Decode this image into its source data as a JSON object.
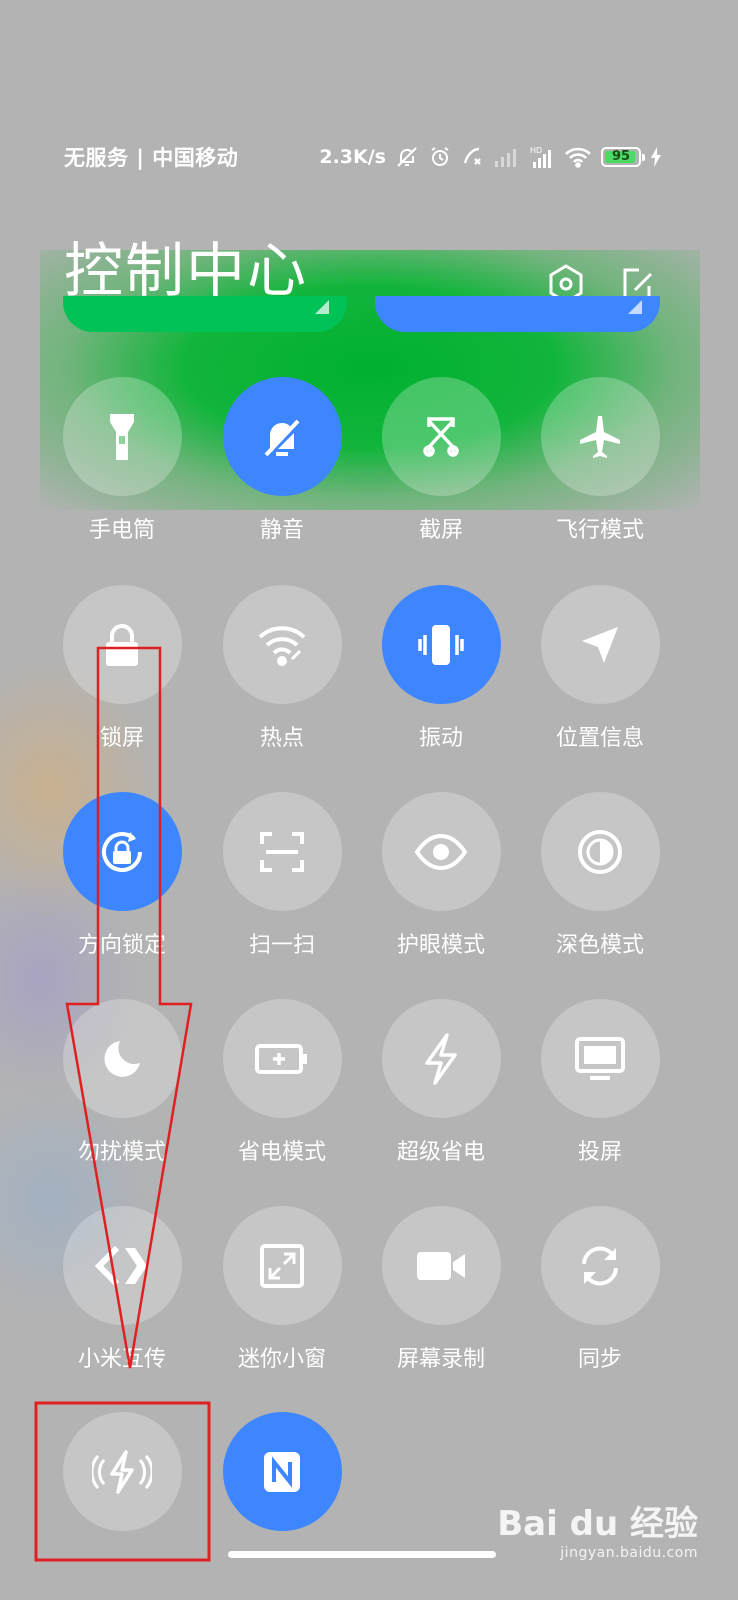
{
  "status_bar": {
    "carrier": "无服务 | 中国移动",
    "speed": "2.3K/s",
    "battery": "95",
    "icons": [
      "mute-bell-icon",
      "alarm-icon",
      "call-icon",
      "signal-icon",
      "hd-signal-icon",
      "wifi-icon",
      "battery-icon",
      "charging-icon"
    ]
  },
  "header": {
    "title": "控制中心",
    "icons": [
      "settings-hex-icon",
      "edit-icon"
    ]
  },
  "sliders": {
    "left_color": "#00c257",
    "right_color": "#3d86ff"
  },
  "accent": "#3d86ff",
  "tiles": [
    {
      "label": "手电筒",
      "icon": "flashlight-icon",
      "active": false
    },
    {
      "label": "静音",
      "icon": "mute-bell-icon",
      "active": true
    },
    {
      "label": "截屏",
      "icon": "screenshot-icon",
      "active": false
    },
    {
      "label": "飞行模式",
      "icon": "airplane-icon",
      "active": false
    },
    {
      "label": "锁屏",
      "icon": "lock-icon",
      "active": false
    },
    {
      "label": "热点",
      "icon": "hotspot-icon",
      "active": false
    },
    {
      "label": "振动",
      "icon": "vibrate-icon",
      "active": true
    },
    {
      "label": "位置信息",
      "icon": "location-icon",
      "active": false
    },
    {
      "label": "方向锁定",
      "icon": "rotation-lock-icon",
      "active": true
    },
    {
      "label": "扫一扫",
      "icon": "scan-icon",
      "active": false
    },
    {
      "label": "护眼模式",
      "icon": "eye-icon",
      "active": false
    },
    {
      "label": "深色模式",
      "icon": "dark-mode-icon",
      "active": false
    },
    {
      "label": "勿扰模式",
      "icon": "moon-icon",
      "active": false
    },
    {
      "label": "省电模式",
      "icon": "battery-saver-icon",
      "active": false
    },
    {
      "label": "超级省电",
      "icon": "bolt-icon",
      "active": false
    },
    {
      "label": "投屏",
      "icon": "cast-screen-icon",
      "active": false
    },
    {
      "label": "小米互传",
      "icon": "mi-share-icon",
      "active": false
    },
    {
      "label": "迷你小窗",
      "icon": "mini-window-icon",
      "active": false
    },
    {
      "label": "屏幕录制",
      "icon": "video-icon",
      "active": false
    },
    {
      "label": "同步",
      "icon": "sync-icon",
      "active": false
    },
    {
      "label": "",
      "icon": "wireless-charge-icon",
      "active": false
    },
    {
      "label": "",
      "icon": "nfc-icon",
      "active": true
    }
  ],
  "annotations": {
    "arrow_color": "#e02020",
    "box_color": "#e02020"
  },
  "watermark": {
    "brand": "Bai du 经验",
    "url": "jingyan.baidu.com"
  }
}
